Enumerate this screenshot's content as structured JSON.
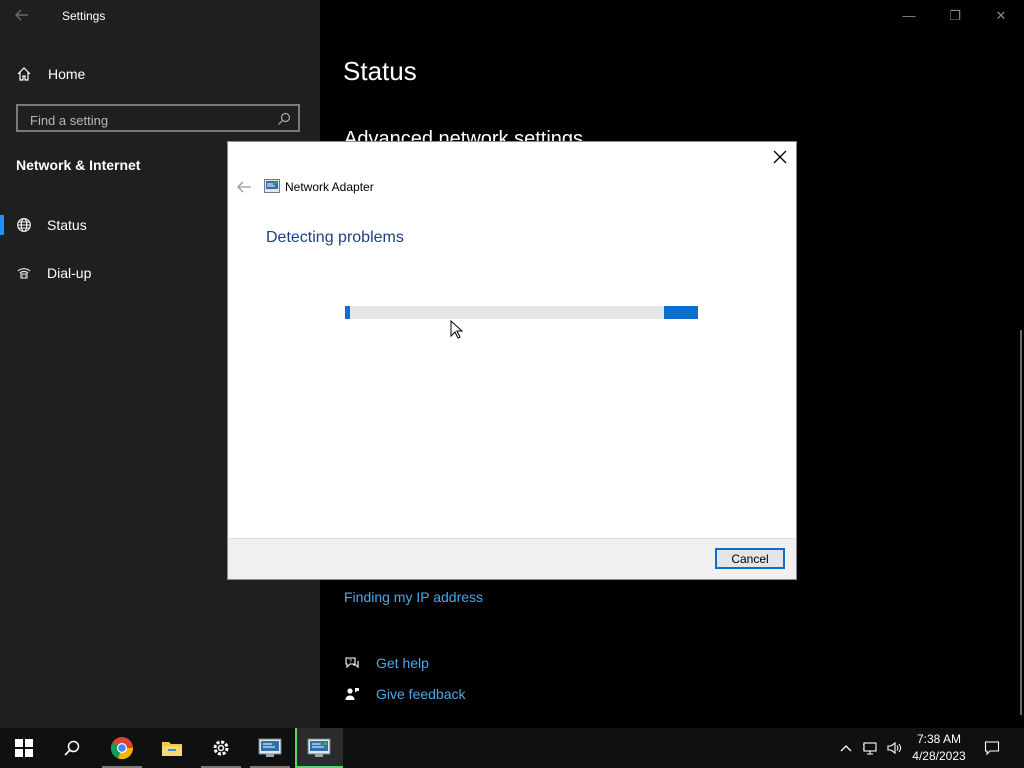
{
  "window": {
    "title": "Settings",
    "minimize_glyph": "—",
    "restore_glyph": "❐",
    "close_glyph": "✕"
  },
  "sidebar": {
    "home_label": "Home",
    "search_placeholder": "Find a setting",
    "section_title": "Network & Internet",
    "items": [
      {
        "label": "Status",
        "icon": "globe-icon",
        "selected": true
      },
      {
        "label": "Dial-up",
        "icon": "dialup-icon",
        "selected": false
      }
    ]
  },
  "main": {
    "page_title": "Status",
    "subtitle": "Advanced network settings",
    "links": {
      "finding_ip": "Finding my IP address"
    },
    "help": {
      "get_help": "Get help",
      "give_feedback": "Give feedback"
    }
  },
  "dialog": {
    "app_title": "Network Adapter",
    "heading": "Detecting problems",
    "cancel_label": "Cancel",
    "progress": {
      "state": "indeterminate"
    }
  },
  "taskbar": {
    "apps": [
      "start-icon",
      "search-icon",
      "chrome-icon",
      "file-explorer-icon",
      "settings-icon",
      "network-diagnostics-icon",
      "troubleshooter-icon"
    ],
    "clock_time": "7:38 AM",
    "clock_date": "4/28/2023"
  },
  "colors": {
    "accent": "#0a6fd0",
    "link": "#4aa8e8",
    "heading_blue": "#1c3f87",
    "sidebar_bg": "#1f1f1f"
  }
}
